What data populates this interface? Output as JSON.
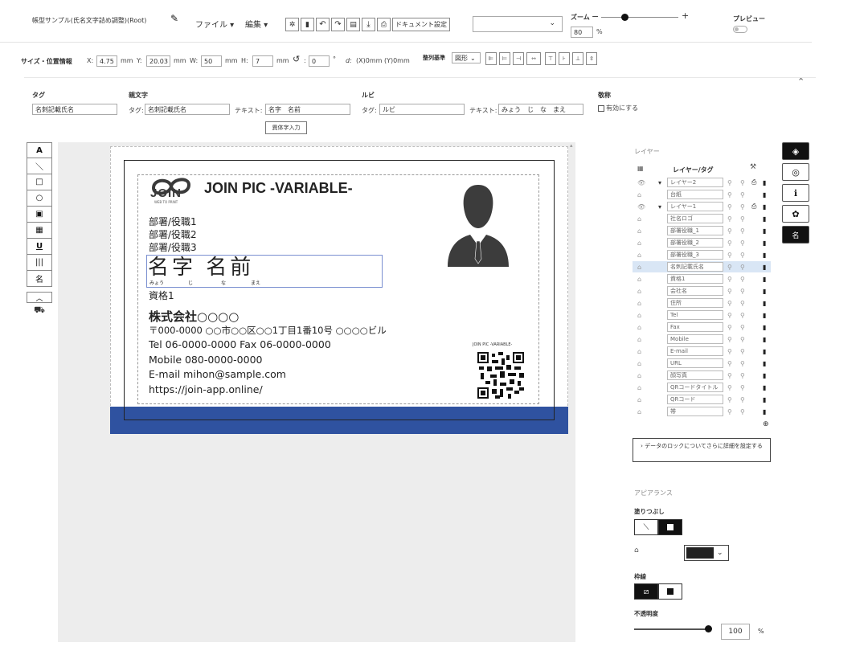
{
  "header": {
    "doc_title": "帳型サンプル(氏名文字詰め調整)(Root)",
    "menu_file": "ファイル",
    "menu_edit": "編集",
    "doc_settings": "ドキュメント設定",
    "zoom_label": "ズーム",
    "zoom_value": "80",
    "zoom_unit": "%",
    "zoom_level": 0.3,
    "preview_label": "プレビュー"
  },
  "geometry_bar": {
    "label": "サイズ・位置情報",
    "x_label": "X:",
    "x_value": "4.75",
    "x_unit": "mm",
    "y_label": "Y:",
    "y_value": "20.03",
    "y_unit": "mm",
    "w_label": "W:",
    "w_value": "50",
    "w_unit": "mm",
    "h_label": "H:",
    "h_value": "7",
    "h_unit": "mm",
    "rot_value": "0",
    "rot_unit": "°",
    "offset_text": "(X)0mm (Y)0mm",
    "align_label": "整列基準",
    "align_value": "図形"
  },
  "props": {
    "tag_header": "タグ",
    "tag_value": "名刺記載氏名",
    "parent_header": "親文字",
    "parent_tag_label": "タグ:",
    "parent_tag_value": "名刺記載氏名",
    "parent_text_label": "テキスト:",
    "parent_text_value": "名字　名前",
    "variant_button": "異体字入力",
    "ruby_header": "ルビ",
    "ruby_tag_label": "タグ:",
    "ruby_tag_value": "ルビ",
    "ruby_text_label": "テキスト:",
    "ruby_text_value": "みょう　じ　な　まえ",
    "honorific_header": "敬称",
    "honorific_checkbox": "有効にする"
  },
  "tools": [
    "A",
    "＼",
    "□",
    "○",
    "▣",
    "▦",
    "U",
    "|||",
    "名"
  ],
  "card": {
    "logo_text": "JOIN",
    "logo_sub": "WEB TO PRINT",
    "headline": "JOIN PIC  -VARIABLE-",
    "dept1": "部署/役職1",
    "dept2": "部署/役職2",
    "dept3": "部署/役職3",
    "name": "名字 名前",
    "ruby": [
      "みょう",
      "じ",
      "な",
      "まえ"
    ],
    "qualification": "資格1",
    "company": "株式会社○○○○",
    "address": "〒000-0000 ○○市○○区○○1丁目1番10号 ○○○○ビル",
    "tel": "Tel 06-0000-0000  Fax 06-0000-0000",
    "mobile": "Mobile 080-0000-0000",
    "email": "E-mail mihon@sample.com",
    "url": "https://join-app.online/",
    "qr_caption": "JOIN PIC -VARIABLE-",
    "colors": {
      "band": "#2f52a0",
      "text": "#222222"
    }
  },
  "layers": {
    "title": "レイヤー",
    "header_label": "レイヤー/タグ",
    "rows": [
      {
        "name": "レイヤー2"
      },
      {
        "name": "台紙"
      },
      {
        "name": "レイヤー1"
      },
      {
        "name": "社名ロゴ"
      },
      {
        "name": "部署役職_1"
      },
      {
        "name": "部署役職_2"
      },
      {
        "name": "部署役職_3"
      },
      {
        "name": "名刺記載氏名",
        "selected": true
      },
      {
        "name": "資格1"
      },
      {
        "name": "会社名"
      },
      {
        "name": "住所"
      },
      {
        "name": "Tel"
      },
      {
        "name": "Fax"
      },
      {
        "name": "Mobile"
      },
      {
        "name": "E-mail"
      },
      {
        "name": "URL"
      },
      {
        "name": "顔写真"
      },
      {
        "name": "QRコードタイトル"
      },
      {
        "name": "QRコード"
      },
      {
        "name": "帯"
      }
    ],
    "lock_info": "データのロックについてさらに詳細を設定する"
  },
  "appearance": {
    "title": "アピアランス",
    "fill_label": "塗りつぶし",
    "stroke_label": "枠線",
    "opacity_label": "不透明度",
    "opacity_value": "100",
    "opacity_unit": "%",
    "fill_color": "#222222"
  }
}
